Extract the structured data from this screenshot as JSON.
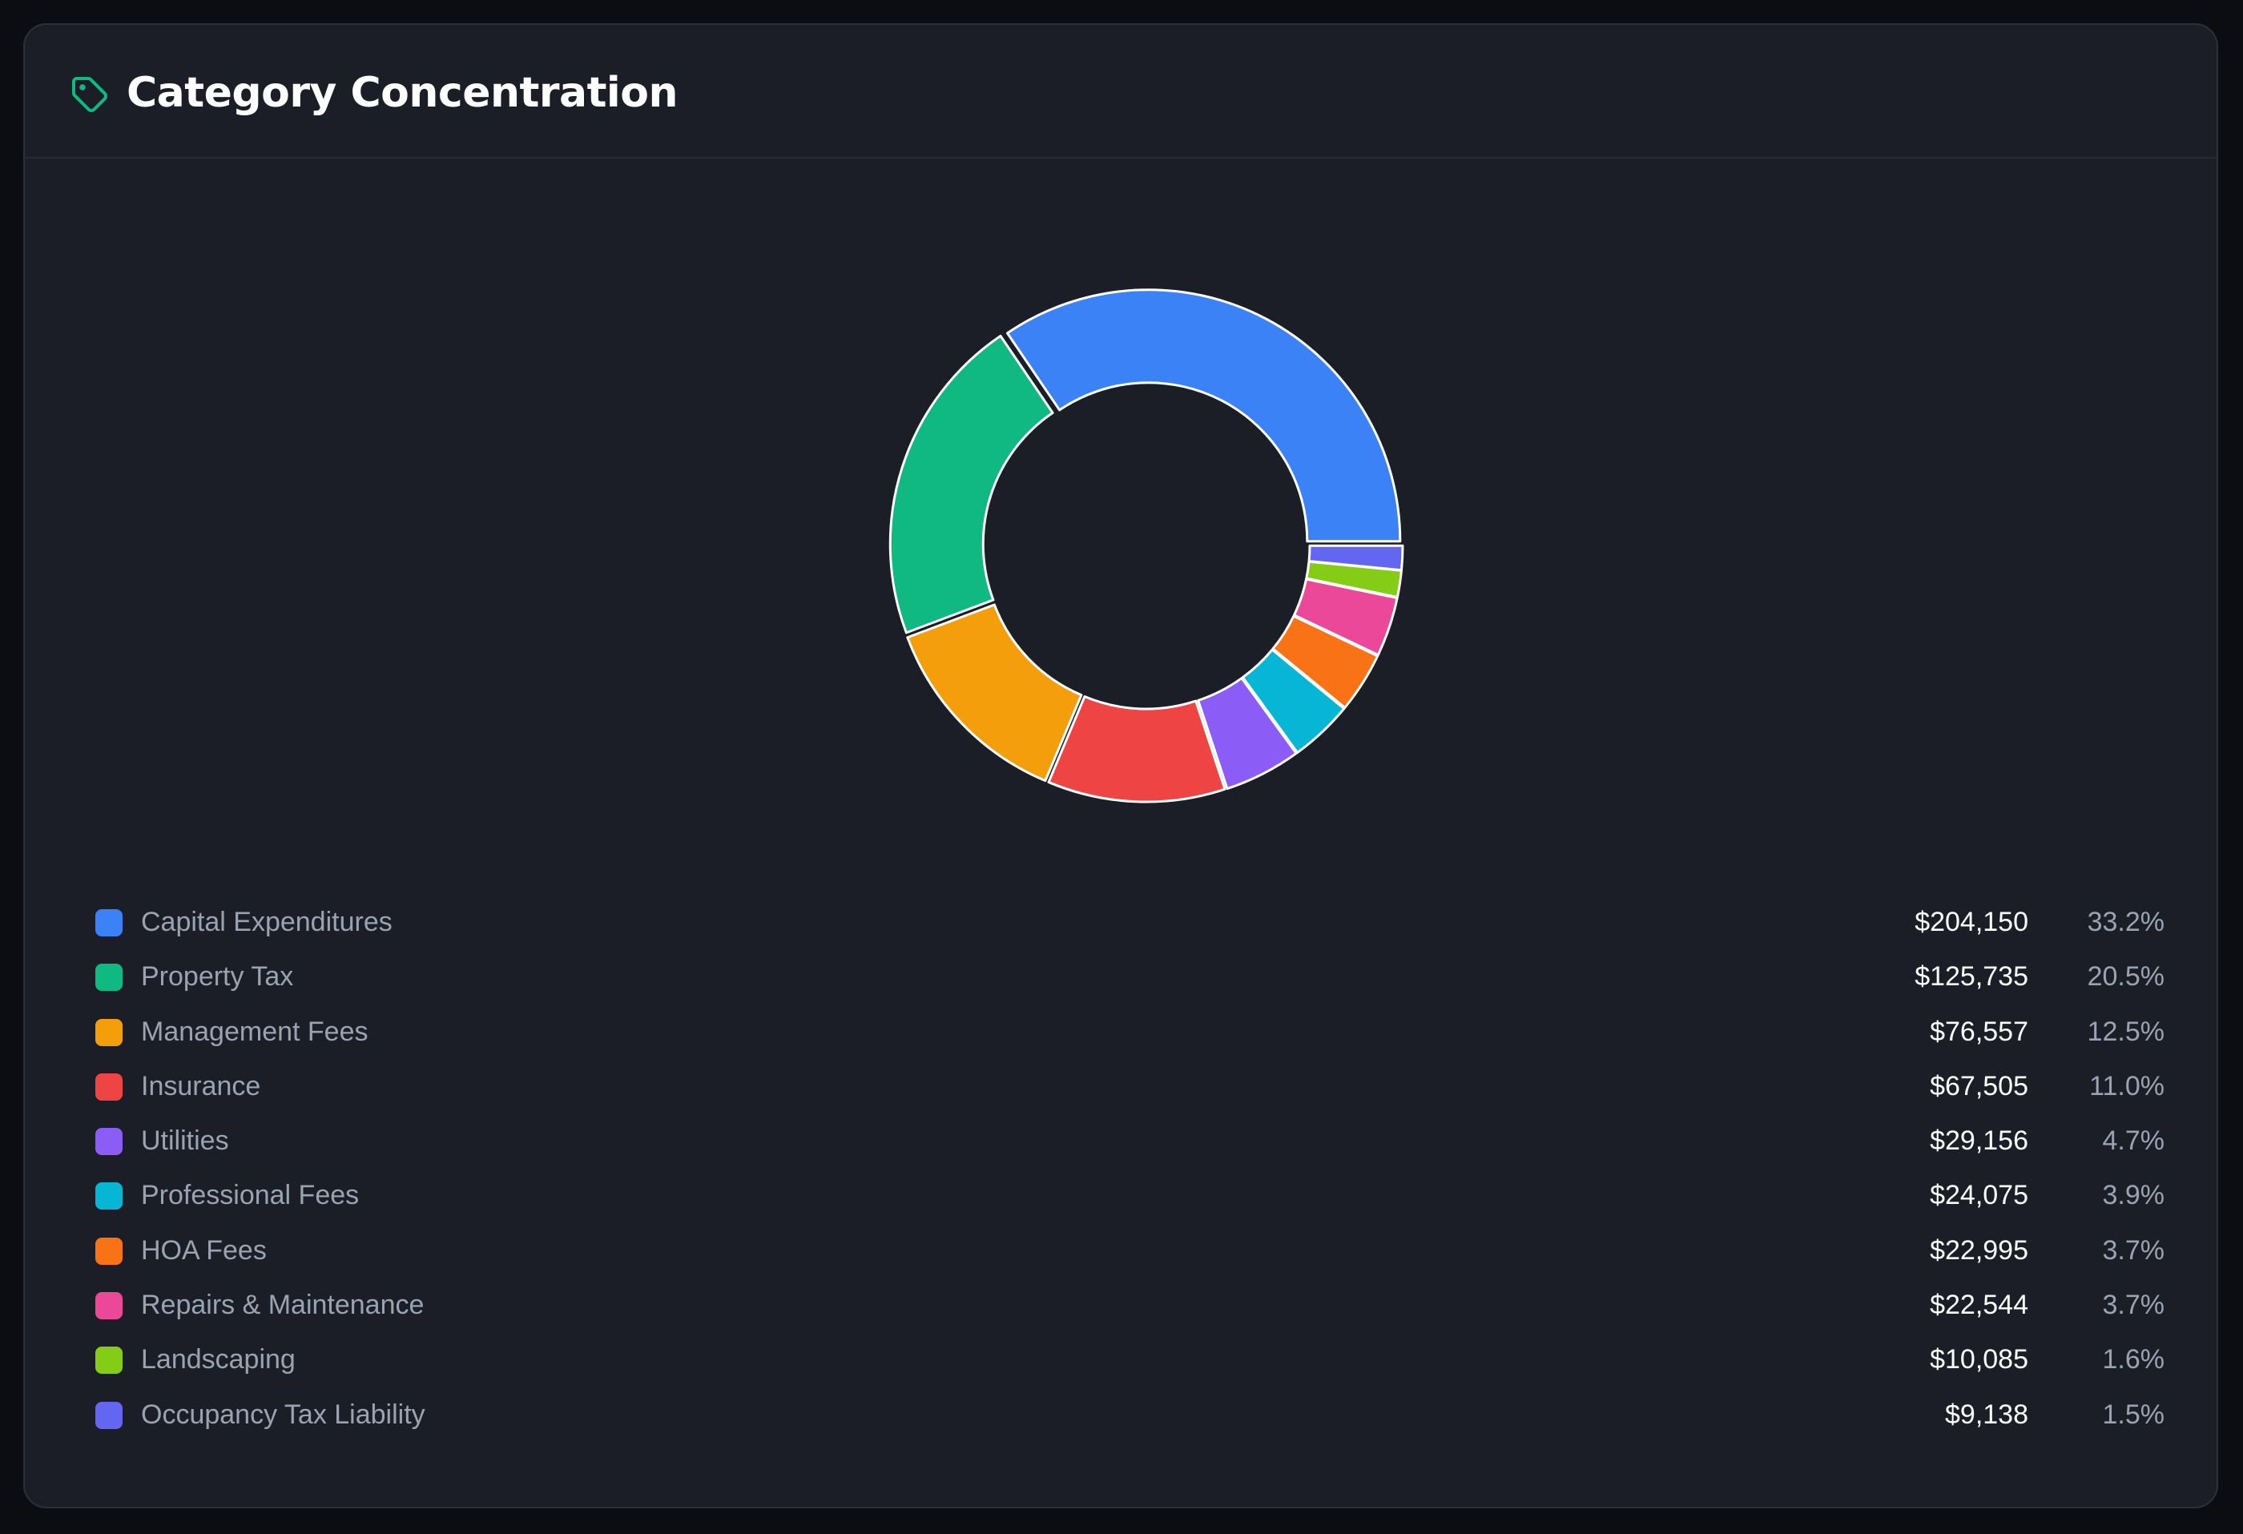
{
  "header": {
    "title": "Category Concentration",
    "icon": "tag-icon",
    "icon_color": "#10b981"
  },
  "colors": {
    "background": "#0b0d12",
    "card": "#1b1e27",
    "slice_stroke": "#ffffff"
  },
  "chart_data": {
    "type": "pie",
    "donut": true,
    "start_angle_deg": 90,
    "direction": "clockwise",
    "legend_position": "bottom",
    "categories": [
      "Capital Expenditures",
      "Property Tax",
      "Management Fees",
      "Insurance",
      "Utilities",
      "Professional Fees",
      "HOA Fees",
      "Repairs & Maintenance",
      "Landscaping",
      "Occupancy Tax Liability"
    ],
    "values": [
      204150,
      125735,
      76557,
      67505,
      29156,
      24075,
      22995,
      22544,
      10085,
      9138
    ],
    "amount_labels": [
      "$204,150",
      "$125,735",
      "$76,557",
      "$67,505",
      "$29,156",
      "$24,075",
      "$22,995",
      "$22,544",
      "$10,085",
      "$9,138"
    ],
    "percent_labels": [
      "33.2%",
      "20.5%",
      "12.5%",
      "11.0%",
      "4.7%",
      "3.9%",
      "3.7%",
      "3.7%",
      "1.6%",
      "1.5%"
    ],
    "colors": [
      "#3b82f6",
      "#10b981",
      "#f59e0b",
      "#ef4444",
      "#8b5cf6",
      "#06b6d4",
      "#f97316",
      "#ec4899",
      "#84cc16",
      "#6366f1"
    ]
  }
}
